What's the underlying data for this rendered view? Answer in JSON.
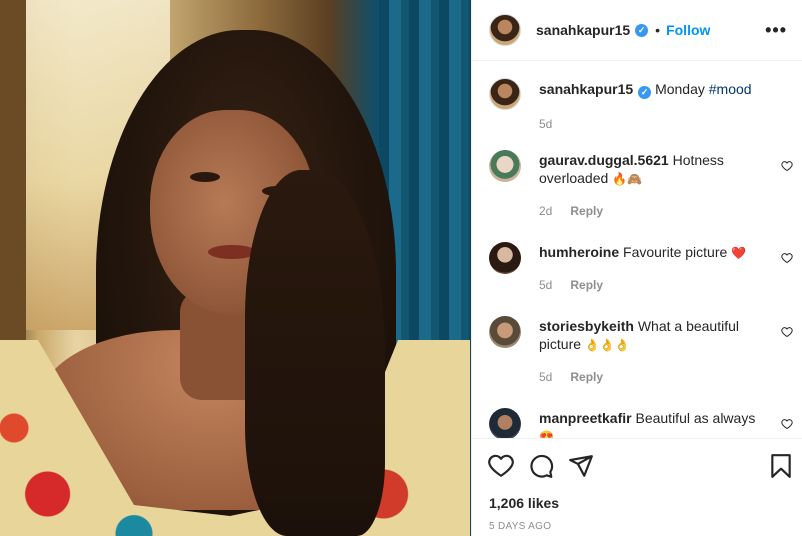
{
  "post": {
    "username": "sanahkapur15",
    "follow_label": "Follow",
    "dot": "•",
    "more": "•••",
    "verified_glyph": "✓"
  },
  "caption": {
    "username": "sanahkapur15",
    "text": "Monday",
    "hashtag": "#mood",
    "time": "5d"
  },
  "comments": [
    {
      "username": "gaurav.duggal.5621",
      "text": "Hotness overloaded",
      "emoji": "🔥🙈",
      "time": "2d",
      "reply": "Reply"
    },
    {
      "username": "humheroine",
      "text": "Favourite picture",
      "emoji": "❤️",
      "time": "5d",
      "reply": "Reply"
    },
    {
      "username": "storiesbykeith",
      "text": "What a beautiful picture",
      "emoji": "👌👌👌",
      "time": "5d",
      "reply": "Reply"
    },
    {
      "username": "manpreetkafir",
      "text": "Beautiful as always",
      "emoji": "😍",
      "time": "",
      "reply": ""
    }
  ],
  "footer": {
    "likes": "1,206 likes",
    "time_ago": "5 DAYS AGO"
  },
  "colors": {
    "accent": "#0095f6",
    "verified": "#3897f0",
    "muted": "#8e8e8e",
    "text": "#262626"
  },
  "icons": [
    "heart-icon",
    "comment-icon",
    "share-icon",
    "bookmark-icon",
    "more-options-icon",
    "verified-badge-icon"
  ]
}
